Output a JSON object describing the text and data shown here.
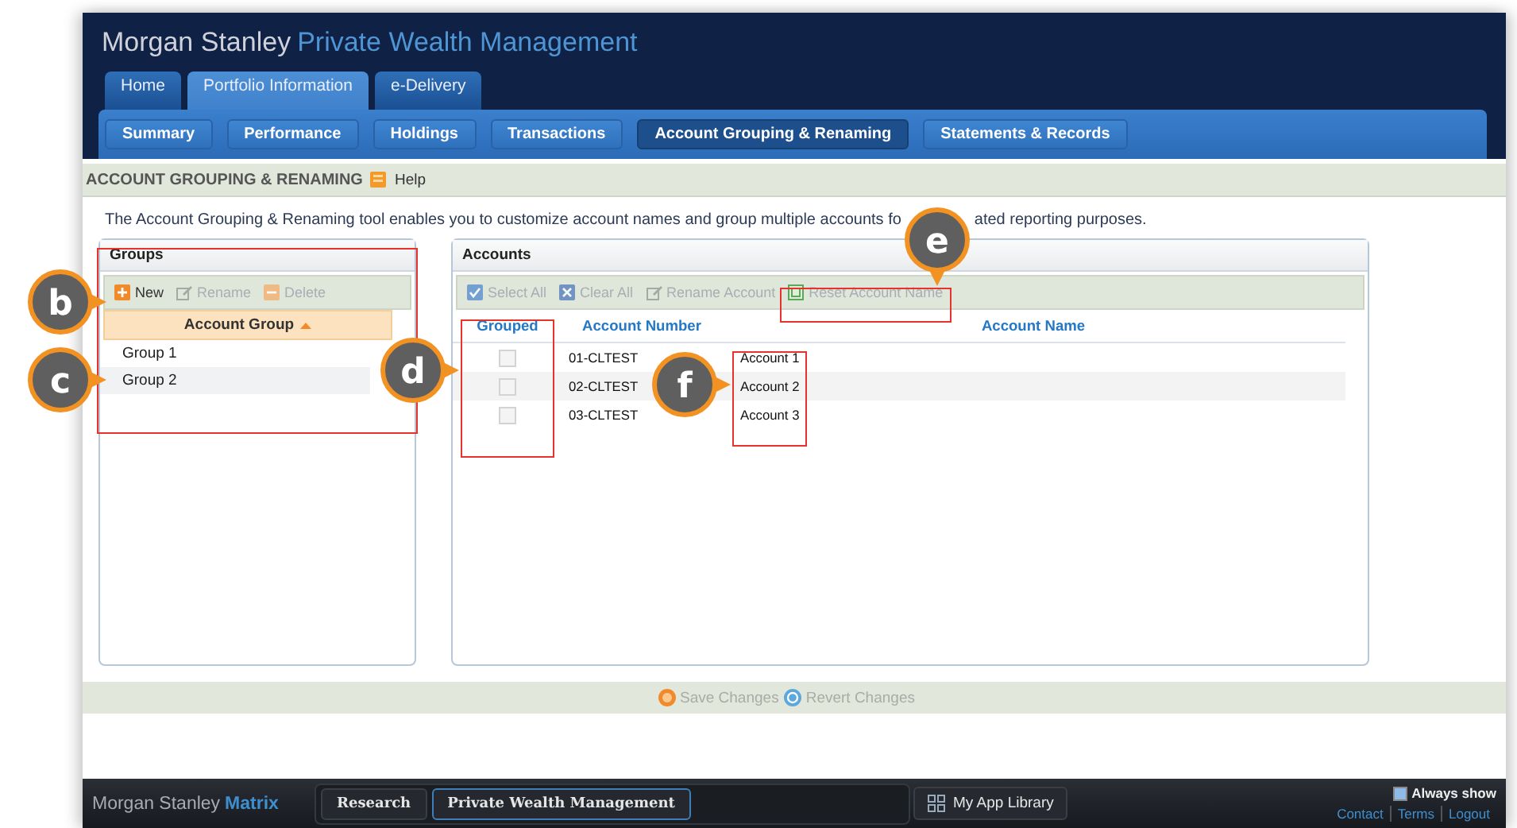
{
  "header": {
    "brand": "Morgan Stanley",
    "product": "Private Wealth Management"
  },
  "main_tabs": [
    {
      "label": "Home",
      "selected": false
    },
    {
      "label": "Portfolio Information",
      "selected": true
    },
    {
      "label": "e-Delivery",
      "selected": false
    }
  ],
  "sub_tabs": [
    {
      "label": "Summary",
      "selected": false
    },
    {
      "label": "Performance",
      "selected": false
    },
    {
      "label": "Holdings",
      "selected": false
    },
    {
      "label": "Transactions",
      "selected": false
    },
    {
      "label": "Account Grouping & Renaming",
      "selected": true
    },
    {
      "label": "Statements & Records",
      "selected": false
    }
  ],
  "page_title": "ACCOUNT GROUPING & RENAMING",
  "help": "Help",
  "description": [
    "The Account Grouping & Renaming tool enables you to customize account names and group multiple accounts fo",
    "ated reporting purposes."
  ],
  "groups_panel": {
    "title": "Groups",
    "toolbar": [
      {
        "kind": "add",
        "label": "New",
        "disabled": false
      },
      {
        "kind": "rename",
        "label": "Rename",
        "disabled": true
      },
      {
        "kind": "delete",
        "label": "Delete",
        "disabled": true
      }
    ],
    "column": "Account Group",
    "rows": [
      "Group 1",
      "Group 2"
    ]
  },
  "accounts_panel": {
    "title": "Accounts",
    "toolbar": [
      {
        "kind": "select_all",
        "label": "Select All",
        "disabled": true
      },
      {
        "kind": "clear_all",
        "label": "Clear All",
        "disabled": true
      },
      {
        "kind": "rename",
        "label": "Rename Account",
        "disabled": true
      },
      {
        "kind": "reset",
        "label": "Reset Account Name",
        "disabled": true
      }
    ],
    "columns": [
      "Grouped",
      "Account Number",
      "Account Name"
    ],
    "rows": [
      {
        "grouped": false,
        "number": "01-CLTEST",
        "name": "Account 1"
      },
      {
        "grouped": false,
        "number": "02-CLTEST",
        "name": "Account 2"
      },
      {
        "grouped": false,
        "number": "03-CLTEST",
        "name": "Account 3"
      }
    ]
  },
  "actions": [
    {
      "kind": "save",
      "label": "Save Changes",
      "disabled": true
    },
    {
      "kind": "revert",
      "label": "Revert Changes",
      "disabled": true
    }
  ],
  "footer": {
    "brand": "Morgan Stanley",
    "product": "Matrix",
    "tabs": [
      {
        "label": "Research",
        "selected": false
      },
      {
        "label": "Private Wealth Management",
        "selected": true
      }
    ],
    "app_library": "My App Library",
    "always_show": {
      "label": "Always show",
      "checked": true
    },
    "links": [
      "Contact",
      "Terms",
      "Logout"
    ]
  },
  "callouts": [
    {
      "label": "b"
    },
    {
      "label": "c"
    },
    {
      "label": "d"
    },
    {
      "label": "e"
    },
    {
      "label": "f"
    }
  ]
}
